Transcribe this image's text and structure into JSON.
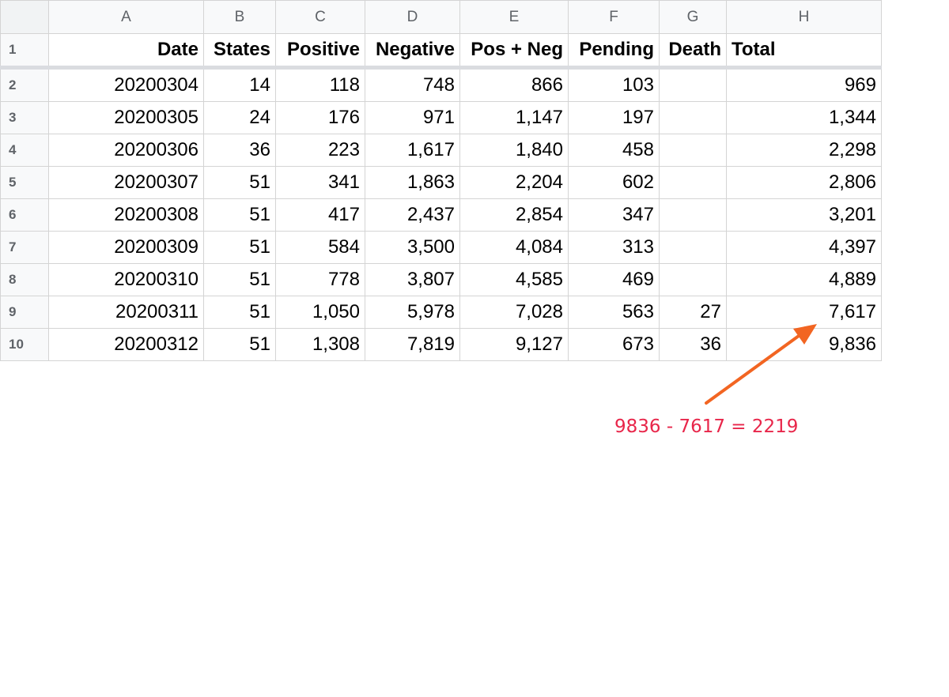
{
  "columns": [
    "A",
    "B",
    "C",
    "D",
    "E",
    "F",
    "G",
    "H"
  ],
  "header_row": {
    "row_number": "1",
    "labels": [
      "Date",
      "States",
      "Positive",
      "Negative",
      "Pos + Neg",
      "Pending",
      "Death",
      "Total"
    ]
  },
  "rows": [
    {
      "n": "2",
      "c": [
        "20200304",
        "14",
        "118",
        "748",
        "866",
        "103",
        "",
        "969"
      ]
    },
    {
      "n": "3",
      "c": [
        "20200305",
        "24",
        "176",
        "971",
        "1,147",
        "197",
        "",
        "1,344"
      ]
    },
    {
      "n": "4",
      "c": [
        "20200306",
        "36",
        "223",
        "1,617",
        "1,840",
        "458",
        "",
        "2,298"
      ]
    },
    {
      "n": "5",
      "c": [
        "20200307",
        "51",
        "341",
        "1,863",
        "2,204",
        "602",
        "",
        "2,806"
      ]
    },
    {
      "n": "6",
      "c": [
        "20200308",
        "51",
        "417",
        "2,437",
        "2,854",
        "347",
        "",
        "3,201"
      ]
    },
    {
      "n": "7",
      "c": [
        "20200309",
        "51",
        "584",
        "3,500",
        "4,084",
        "313",
        "",
        "4,397"
      ]
    },
    {
      "n": "8",
      "c": [
        "20200310",
        "51",
        "778",
        "3,807",
        "4,585",
        "469",
        "",
        "4,889"
      ]
    },
    {
      "n": "9",
      "c": [
        "20200311",
        "51",
        "1,050",
        "5,978",
        "7,028",
        "563",
        "27",
        "7,617"
      ]
    },
    {
      "n": "10",
      "c": [
        "20200312",
        "51",
        "1,308",
        "7,819",
        "9,127",
        "673",
        "36",
        "9,836"
      ]
    }
  ],
  "annotation": {
    "text": "9836 - 7617 = 2219",
    "color": "#e8264a",
    "arrow_color": "#f26522"
  }
}
